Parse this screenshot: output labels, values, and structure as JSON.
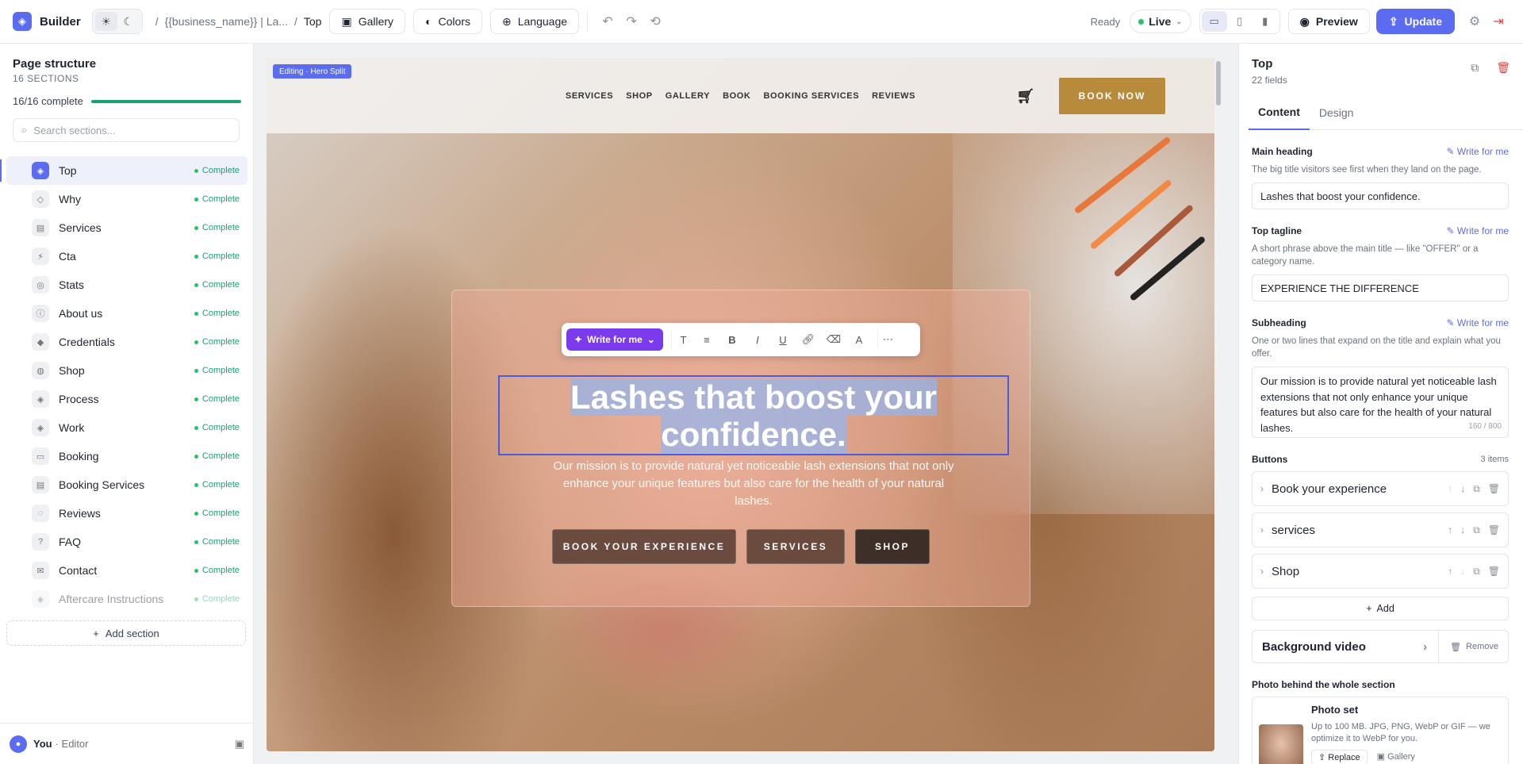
{
  "topbar": {
    "brand": "Builder",
    "crumbs": [
      "{{business_name}} | La...",
      "Top"
    ],
    "gallery": "Gallery",
    "colors": "Colors",
    "language": "Language",
    "status": "Ready",
    "live": "Live",
    "preview": "Preview",
    "update": "Update"
  },
  "sidebar": {
    "title": "Page structure",
    "subtitle": "16 SECTIONS",
    "progress_text": "16/16 complete",
    "progress": 1.0,
    "search_placeholder": "Search sections...",
    "items": [
      {
        "label": "Top",
        "status": "Complete"
      },
      {
        "label": "Why",
        "status": "Complete"
      },
      {
        "label": "Services",
        "status": "Complete"
      },
      {
        "label": "Cta",
        "status": "Complete"
      },
      {
        "label": "Stats",
        "status": "Complete"
      },
      {
        "label": "About us",
        "status": "Complete"
      },
      {
        "label": "Credentials",
        "status": "Complete"
      },
      {
        "label": "Shop",
        "status": "Complete"
      },
      {
        "label": "Process",
        "status": "Complete"
      },
      {
        "label": "Work",
        "status": "Complete"
      },
      {
        "label": "Booking",
        "status": "Complete"
      },
      {
        "label": "Booking Services",
        "status": "Complete"
      },
      {
        "label": "Reviews",
        "status": "Complete"
      },
      {
        "label": "FAQ",
        "status": "Complete"
      },
      {
        "label": "Contact",
        "status": "Complete"
      },
      {
        "label": "Aftercare Instructions",
        "status": "Complete"
      }
    ],
    "add_section": "Add section",
    "user_name": "You",
    "user_role": "· Editor"
  },
  "preview": {
    "editing_badge": "Editing · Hero Split",
    "nav": [
      "SERVICES",
      "SHOP",
      "GALLERY",
      "BOOK",
      "BOOKING SERVICES",
      "REVIEWS"
    ],
    "book_now": "BOOK NOW",
    "write_for_me": "Write for me",
    "headline_line1": "Lashes that boost your",
    "headline_line2": "confidence.",
    "subtext": "Our mission is to provide natural yet noticeable lash extensions that not only enhance your unique features but also care for the health of your natural lashes.",
    "ctas": [
      "BOOK YOUR EXPERIENCE",
      "SERVICES",
      "SHOP"
    ]
  },
  "panel": {
    "title": "Top",
    "subtitle": "22 fields",
    "tabs": [
      "Content",
      "Design"
    ],
    "write_for_me": "Write for me",
    "main_heading_label": "Main heading",
    "main_heading_help": "The big title visitors see first when they land on the page.",
    "main_heading_value": "Lashes that boost your confidence.",
    "tagline_label": "Top tagline",
    "tagline_help": "A short phrase above the main title — like \"OFFER\" or a category name.",
    "tagline_value": "EXPERIENCE THE DIFFERENCE",
    "subheading_label": "Subheading",
    "subheading_help": "One or two lines that expand on the title and explain what you offer.",
    "subheading_value": "Our mission is to provide natural yet noticeable lash extensions that not only enhance your unique features but also care for the health of your natural lashes.",
    "subheading_count": "160 / 800",
    "buttons_label": "Buttons",
    "buttons_count": "3 items",
    "buttons": [
      "Book your experience",
      "services",
      "Shop"
    ],
    "add": "Add",
    "bg_video": "Background video",
    "remove": "Remove",
    "photo_label": "Photo behind the whole section",
    "photo_set_title": "Photo set",
    "photo_help": "Up to 100 MB. JPG, PNG, WebP or GIF — we optimize it to WebP for you.",
    "replace": "Replace",
    "gallery": "Gallery"
  },
  "colors": {
    "accent": "#5b6cf0",
    "success": "#16a37a",
    "gold": "#b88a3c",
    "ai": "#7c3aed",
    "danger": "#e04444"
  }
}
